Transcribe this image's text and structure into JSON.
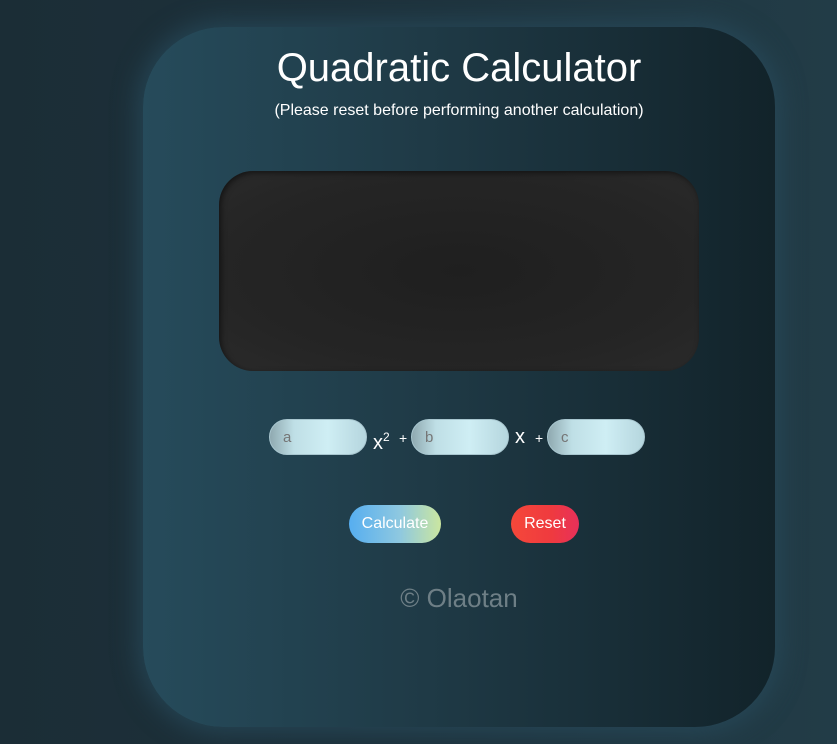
{
  "app": {
    "title": "Quadratic Calculator",
    "subtitle": "(Please reset before performing another calculation)"
  },
  "display": {
    "text": ""
  },
  "equation": {
    "a_placeholder": "a",
    "b_placeholder": "b",
    "c_placeholder": "c",
    "x_squared_base": "x",
    "x_squared_exp": "2",
    "x_linear": "x",
    "plus_1": "+",
    "plus_2": "+"
  },
  "buttons": {
    "calculate_label": "Calculate",
    "reset_label": "Reset"
  },
  "footer": {
    "credit": "© Olaotan"
  },
  "colors": {
    "background": "#1d313b",
    "card": "#1f3a46",
    "display": "#222222",
    "input": "#cfeef4",
    "calculate_start": "#56aef0",
    "calculate_end": "#cbe6a0",
    "reset": "#ef3a3f",
    "footer_text": "#6e7f86"
  }
}
